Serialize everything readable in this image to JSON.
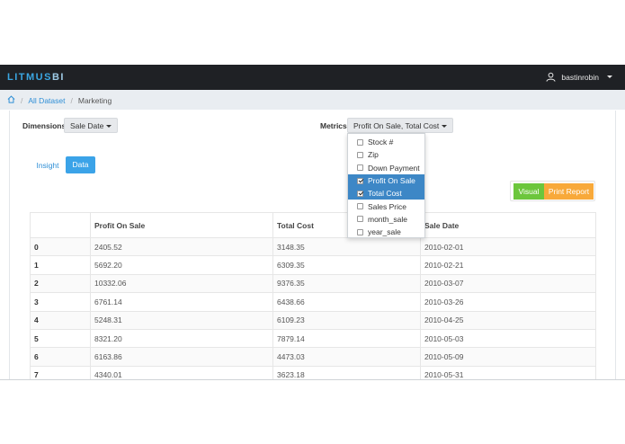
{
  "navbar": {
    "brand_a": "LITMUS",
    "brand_b": "BI",
    "username": "bastinrobin"
  },
  "breadcrumb": {
    "items": [
      "All Dataset",
      "Marketing"
    ]
  },
  "filters": {
    "dimensions_label": "Dimensions",
    "dimensions_value": "Sale Date",
    "metrics_label": "Metrics",
    "metrics_value": "Profit On Sale, Total Cost"
  },
  "metrics_menu": {
    "options": [
      {
        "label": "Stock #",
        "checked": false
      },
      {
        "label": "Zip",
        "checked": false
      },
      {
        "label": "Down Payment",
        "checked": false
      },
      {
        "label": "Profit On Sale",
        "checked": true
      },
      {
        "label": "Total Cost",
        "checked": true
      },
      {
        "label": "Sales Price",
        "checked": false
      },
      {
        "label": "month_sale",
        "checked": false
      },
      {
        "label": "year_sale",
        "checked": false
      }
    ]
  },
  "tabs": {
    "insight": "Insight",
    "data": "Data"
  },
  "actions": {
    "visual": "Visual",
    "print_report": "Print Report"
  },
  "table": {
    "headers": [
      "",
      "Profit On Sale",
      "Total Cost",
      "Sale Date"
    ],
    "rows": [
      [
        "0",
        "2405.52",
        "3148.35",
        "2010-02-01"
      ],
      [
        "1",
        "5692.20",
        "6309.35",
        "2010-02-21"
      ],
      [
        "2",
        "10332.06",
        "9376.35",
        "2010-03-07"
      ],
      [
        "3",
        "6761.14",
        "6438.66",
        "2010-03-26"
      ],
      [
        "4",
        "5248.31",
        "6109.23",
        "2010-04-25"
      ],
      [
        "5",
        "8321.20",
        "7879.14",
        "2010-05-03"
      ],
      [
        "6",
        "6163.86",
        "4473.03",
        "2010-05-09"
      ],
      [
        "7",
        "4340.01",
        "3623.18",
        "2010-05-31"
      ]
    ]
  }
}
